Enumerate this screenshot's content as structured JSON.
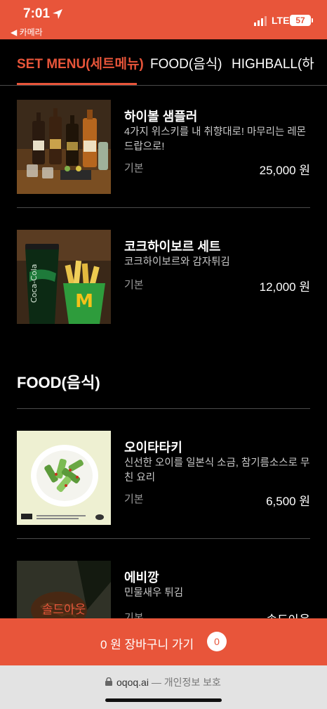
{
  "status_bar": {
    "time": "7:01",
    "back_app": "◀ 카메라",
    "network": "LTE",
    "battery": "57"
  },
  "tabs": [
    {
      "label": "SET MENU(세트메뉴)",
      "active": true
    },
    {
      "label": "FOOD(음식)",
      "active": false
    },
    {
      "label": "HIGHBALL(하",
      "active": false
    }
  ],
  "set_menu": {
    "items": [
      {
        "name": "하이볼 샘플러",
        "description": "4가지 위스키를 내 취향대로! 마무리는 레몬 드랍으로!",
        "option": "기본",
        "price": "25,000 원"
      },
      {
        "name": "코크하이보르 세트",
        "description": "코크하이보르와 감자튀김",
        "option": "기본",
        "price": "12,000 원"
      }
    ]
  },
  "food": {
    "title": "FOOD(음식)",
    "items": [
      {
        "name": "오이타타키",
        "description": "신선한 오이를 일본식 소금, 참기름소스로 무친 요리",
        "option": "기본",
        "price": "6,500 원"
      },
      {
        "name": "에비깡",
        "description": "민물새우 튀김",
        "option": "기본",
        "price": "솔드아웃",
        "soldout_label": "솔드아웃"
      }
    ]
  },
  "cart": {
    "label": "0 원 장바구니 가기",
    "count": "0"
  },
  "browser": {
    "url": "oqoq.ai",
    "privacy": "— 개인정보 보호"
  },
  "colors": {
    "accent": "#e8553a",
    "background": "#000000"
  }
}
